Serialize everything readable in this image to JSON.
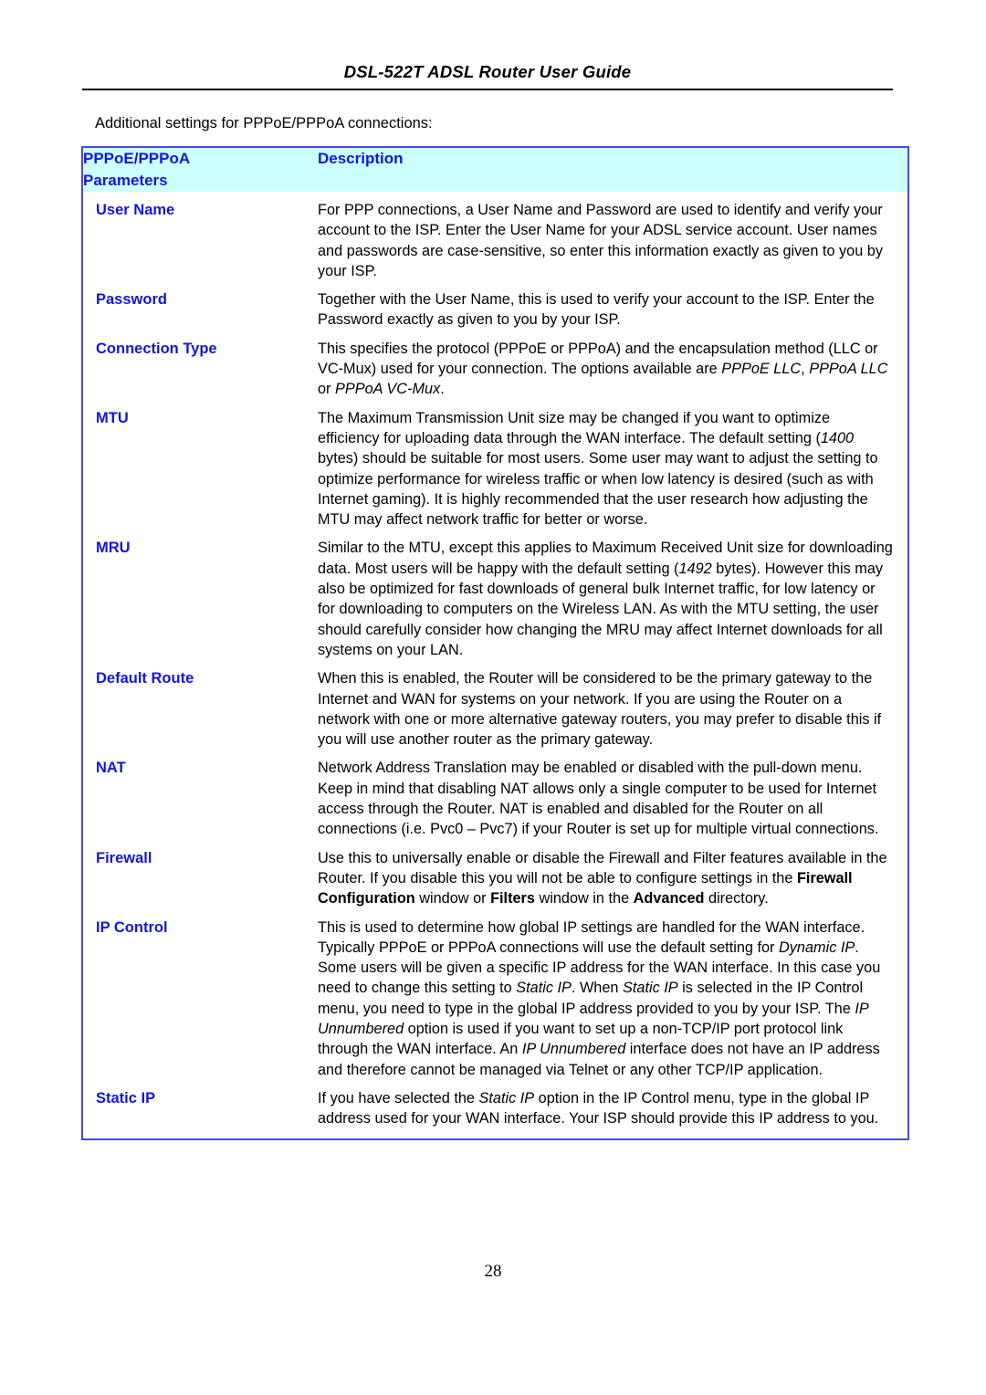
{
  "document": {
    "running_header": "DSL-522T ADSL Router User Guide",
    "page_number": "28",
    "intro_text": "Additional settings for PPPoE/PPPoA connections:"
  },
  "colors": {
    "header_fill": "#CCFFFF",
    "table_border": "#4A4AD8",
    "label_text": "#1414E0",
    "body_text": "#000000"
  },
  "table": {
    "header": {
      "col1_line1": "PPPoE/PPPoA",
      "col1_line2": "Parameters",
      "col2": "Description"
    },
    "rows": [
      {
        "parameter": "User Name",
        "description": "For PPP connections, a User Name and Password are used to identify and verify your account to the ISP. Enter the User Name for your ADSL service account. User names and passwords are case-sensitive, so enter this information exactly as given to you by your ISP."
      },
      {
        "parameter": "Password",
        "description": "Together with the User Name, this is used to verify your account to the ISP. Enter the Password exactly as given to you by your ISP."
      },
      {
        "parameter": "Connection Type",
        "description": "This specifies the protocol (PPPoE or PPPoA) and the encapsulation method (LLC or VC-Mux) used for your connection. The options available are PPPoE LLC, PPPoA LLC or PPPoA VC-Mux.",
        "emphasis_italic": [
          "PPPoE LLC",
          "PPPoA LLC",
          "PPPoA VC-Mux"
        ]
      },
      {
        "parameter": "MTU",
        "description": "The Maximum Transmission Unit size may be changed if you want to optimize efficiency for uploading data through the WAN interface. The default setting (1400 bytes) should be suitable for most users. Some user may want to adjust the setting to optimize performance for wireless traffic or when low latency is desired (such as with Internet gaming). It is highly recommended that the user research how adjusting the MTU may affect network traffic for better or worse.",
        "emphasis_italic": [
          "1400"
        ]
      },
      {
        "parameter": "MRU",
        "description": "Similar to the MTU, except this applies to Maximum Received Unit size for downloading data. Most users will be happy with the default setting (1492 bytes). However this may also be optimized for fast downloads of general bulk Internet traffic, for low latency or for downloading to computers on the Wireless LAN. As with the MTU setting, the user should carefully consider how changing the MRU may affect Internet downloads for all systems on your LAN.",
        "emphasis_italic": [
          "1492"
        ]
      },
      {
        "parameter": "Default Route",
        "description": "When this is enabled, the Router will be considered to be the primary gateway to the Internet and WAN for systems on your network. If you are using the Router on a network with one or more alternative gateway routers, you may prefer to disable this if you will use another router as the primary gateway."
      },
      {
        "parameter": "NAT",
        "description": "Network Address Translation may be enabled or disabled with the pull-down menu. Keep in mind that disabling NAT allows only a single computer to be used for Internet access through the Router. NAT is enabled and disabled for the Router on all connections (i.e. Pvc0 – Pvc7) if your Router is set up for multiple virtual connections."
      },
      {
        "parameter": "Firewall",
        "description": "Use this to universally enable or disable the Firewall and Filter features available in the Router. If you disable this you will not be able to configure settings in the Firewall Configuration window or Filters window in the Advanced directory.",
        "emphasis_bold": [
          "Firewall Configuration",
          "Filters",
          "Advanced"
        ]
      },
      {
        "parameter": "IP Control",
        "description": "This is used to determine how global IP settings are handled for the WAN interface. Typically PPPoE or PPPoA connections will use the default setting for Dynamic IP. Some users will be given a specific IP address for the WAN interface. In this case you need to change this setting to Static IP. When Static IP is selected in the IP Control menu, you need to type in the global IP address provided to you by your ISP. The IP Unnumbered option is used if you want to set up a non-TCP/IP port protocol link through the WAN interface. An IP Unnumbered interface does not have an IP address and therefore cannot be managed via Telnet or any other TCP/IP application.",
        "emphasis_italic": [
          "Dynamic IP",
          "Static IP",
          "IP Unnumbered"
        ]
      },
      {
        "parameter": "Static IP",
        "description": "If you have selected the Static IP option in the IP Control menu, type in the global IP address used for your WAN interface. Your ISP should provide this IP address to you.",
        "emphasis_italic": [
          "Static IP"
        ]
      }
    ]
  }
}
